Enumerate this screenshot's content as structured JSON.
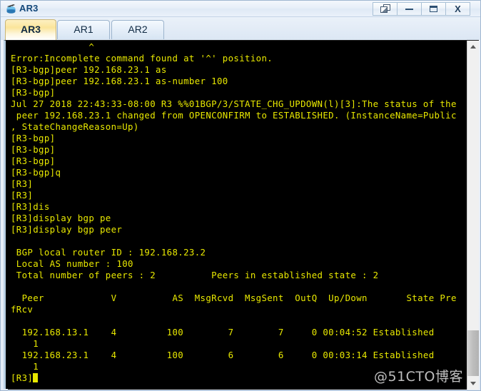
{
  "window": {
    "title": "AR3",
    "icon": "router-icon",
    "controls": {
      "restore": "restore-window",
      "minimize": "minimize-window",
      "maximize": "maximize-window",
      "close": "X"
    }
  },
  "tabs": [
    {
      "label": "AR3",
      "active": true
    },
    {
      "label": "AR1",
      "active": false
    },
    {
      "label": "AR2",
      "active": false
    }
  ],
  "terminal": {
    "foreground_color": "#e8e800",
    "background_color": "#000000",
    "lines": [
      "              ^",
      "Error:Incomplete command found at '^' position.",
      "[R3-bgp]peer 192.168.23.1 as",
      "[R3-bgp]peer 192.168.23.1 as-number 100",
      "[R3-bgp]",
      "Jul 27 2018 22:43:33-08:00 R3 %%01BGP/3/STATE_CHG_UPDOWN(l)[3]:The status of the",
      " peer 192.168.23.1 changed from OPENCONFIRM to ESTABLISHED. (InstanceName=Public",
      ", StateChangeReason=Up)",
      "[R3-bgp]",
      "[R3-bgp]",
      "[R3-bgp]",
      "[R3-bgp]q",
      "[R3]",
      "[R3]",
      "[R3]dis",
      "[R3]display bgp pe",
      "[R3]display bgp peer",
      "",
      " BGP local router ID : 192.168.23.2",
      " Local AS number : 100",
      " Total number of peers : 2          Peers in established state : 2",
      "",
      "  Peer            V          AS  MsgRcvd  MsgSent  OutQ  Up/Down       State Pre",
      "fRcv",
      "",
      "  192.168.13.1    4         100        7        7     0 00:04:52 Established",
      "    1",
      "  192.168.23.1    4         100        6        6     0 00:03:14 Established",
      "    1",
      "[R3]"
    ],
    "prompt_cursor": true
  },
  "bgp_summary": {
    "local_router_id_label": "BGP local router ID",
    "local_router_id": "192.168.23.2",
    "local_as_label": "Local AS number",
    "local_as": "100",
    "total_peers_label": "Total number of peers",
    "total_peers": "2",
    "established_peers_label": "Peers in established state",
    "established_peers": "2",
    "columns": [
      "Peer",
      "V",
      "AS",
      "MsgRcvd",
      "MsgSent",
      "OutQ",
      "Up/Down",
      "State",
      "PrefRcv"
    ],
    "rows": [
      {
        "peer": "192.168.13.1",
        "v": "4",
        "as": "100",
        "msg_rcvd": "7",
        "msg_sent": "7",
        "out_q": "0",
        "up_down": "00:04:52",
        "state": "Established",
        "pref_rcv": "1"
      },
      {
        "peer": "192.168.23.1",
        "v": "4",
        "as": "100",
        "msg_rcvd": "6",
        "msg_sent": "6",
        "out_q": "0",
        "up_down": "00:03:14",
        "state": "Established",
        "pref_rcv": "1"
      }
    ]
  },
  "scrollbar": {
    "up_arrow": "scroll-up",
    "down_arrow": "scroll-down",
    "thumb": "scroll-thumb"
  },
  "watermark": "@51CTO博客"
}
